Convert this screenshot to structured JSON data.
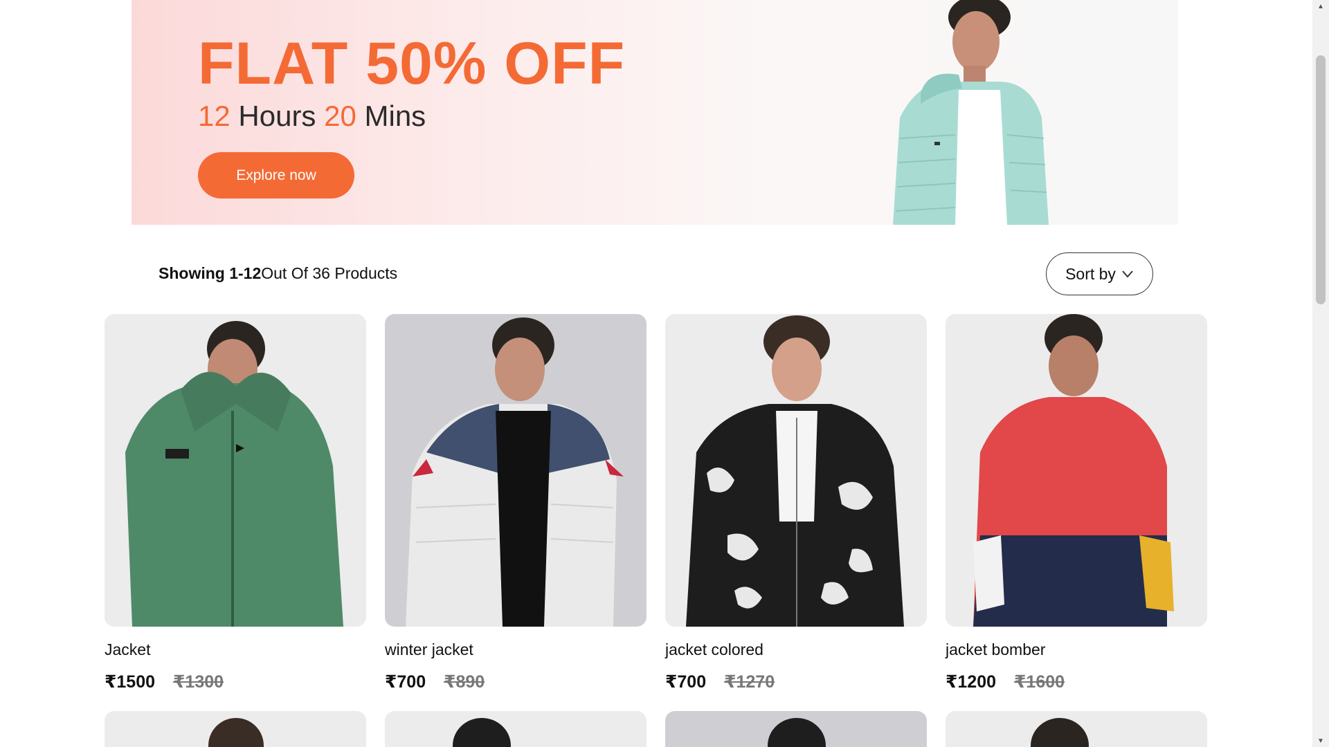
{
  "banner": {
    "title": "FLAT 50% OFF",
    "countdown": {
      "hours_value": "12",
      "hours_label": "Hours",
      "mins_value": "20",
      "mins_label": "Mins"
    },
    "cta_label": "Explore now"
  },
  "results": {
    "showing_bold": "Showing 1-12",
    "showing_rest": "Out Of 36 Products",
    "sort_label": "Sort by"
  },
  "products": [
    {
      "name": "Jacket",
      "price": "₹1500",
      "old_price": "₹1300"
    },
    {
      "name": "winter jacket",
      "price": "₹700",
      "old_price": "₹890"
    },
    {
      "name": "jacket colored",
      "price": "₹700",
      "old_price": "₹1270"
    },
    {
      "name": "jacket bomber",
      "price": "₹1200",
      "old_price": "₹1600"
    }
  ],
  "colors": {
    "accent": "#f46a35",
    "banner_bg": "#fcd9d9"
  },
  "icons": {
    "sort": "chevron-down-icon"
  }
}
